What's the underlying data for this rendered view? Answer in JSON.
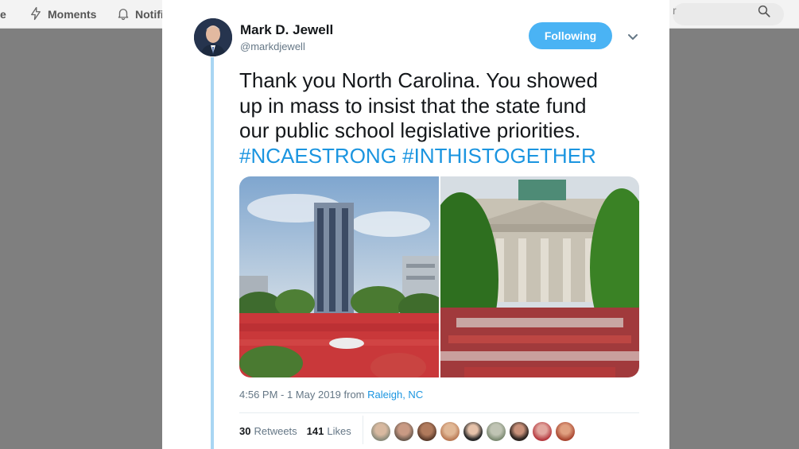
{
  "nav": {
    "home_fragment": "e",
    "moments_label": "Moments",
    "notifications_fragment": "Notifi",
    "search_fragment": "r"
  },
  "tweet": {
    "display_name": "Mark D. Jewell",
    "handle": "@markdjewell",
    "follow_label": "Following",
    "text_lines": [
      "Thank you North Carolina. You showed",
      "up in mass to insist that the state fund",
      "our public school legislative priorities."
    ],
    "hashtags": [
      "#NCAESTRONG",
      "#INTHISTOGETHER"
    ],
    "timestamp": "4:56 PM - 1 May 2019 from ",
    "location": "Raleigh, NC",
    "retweets_count": "30",
    "retweets_label": "Retweets",
    "likes_count": "141",
    "likes_label": "Likes"
  },
  "colors": {
    "accent": "#1b95e0",
    "follow_button": "#4ab3f4",
    "thread_line": "#a9d6f3",
    "backdrop": "#7f7f7f"
  },
  "icons": [
    "lightning-icon",
    "bell-icon",
    "search-icon",
    "chevron-down-icon"
  ],
  "likers_count_shown": 9
}
